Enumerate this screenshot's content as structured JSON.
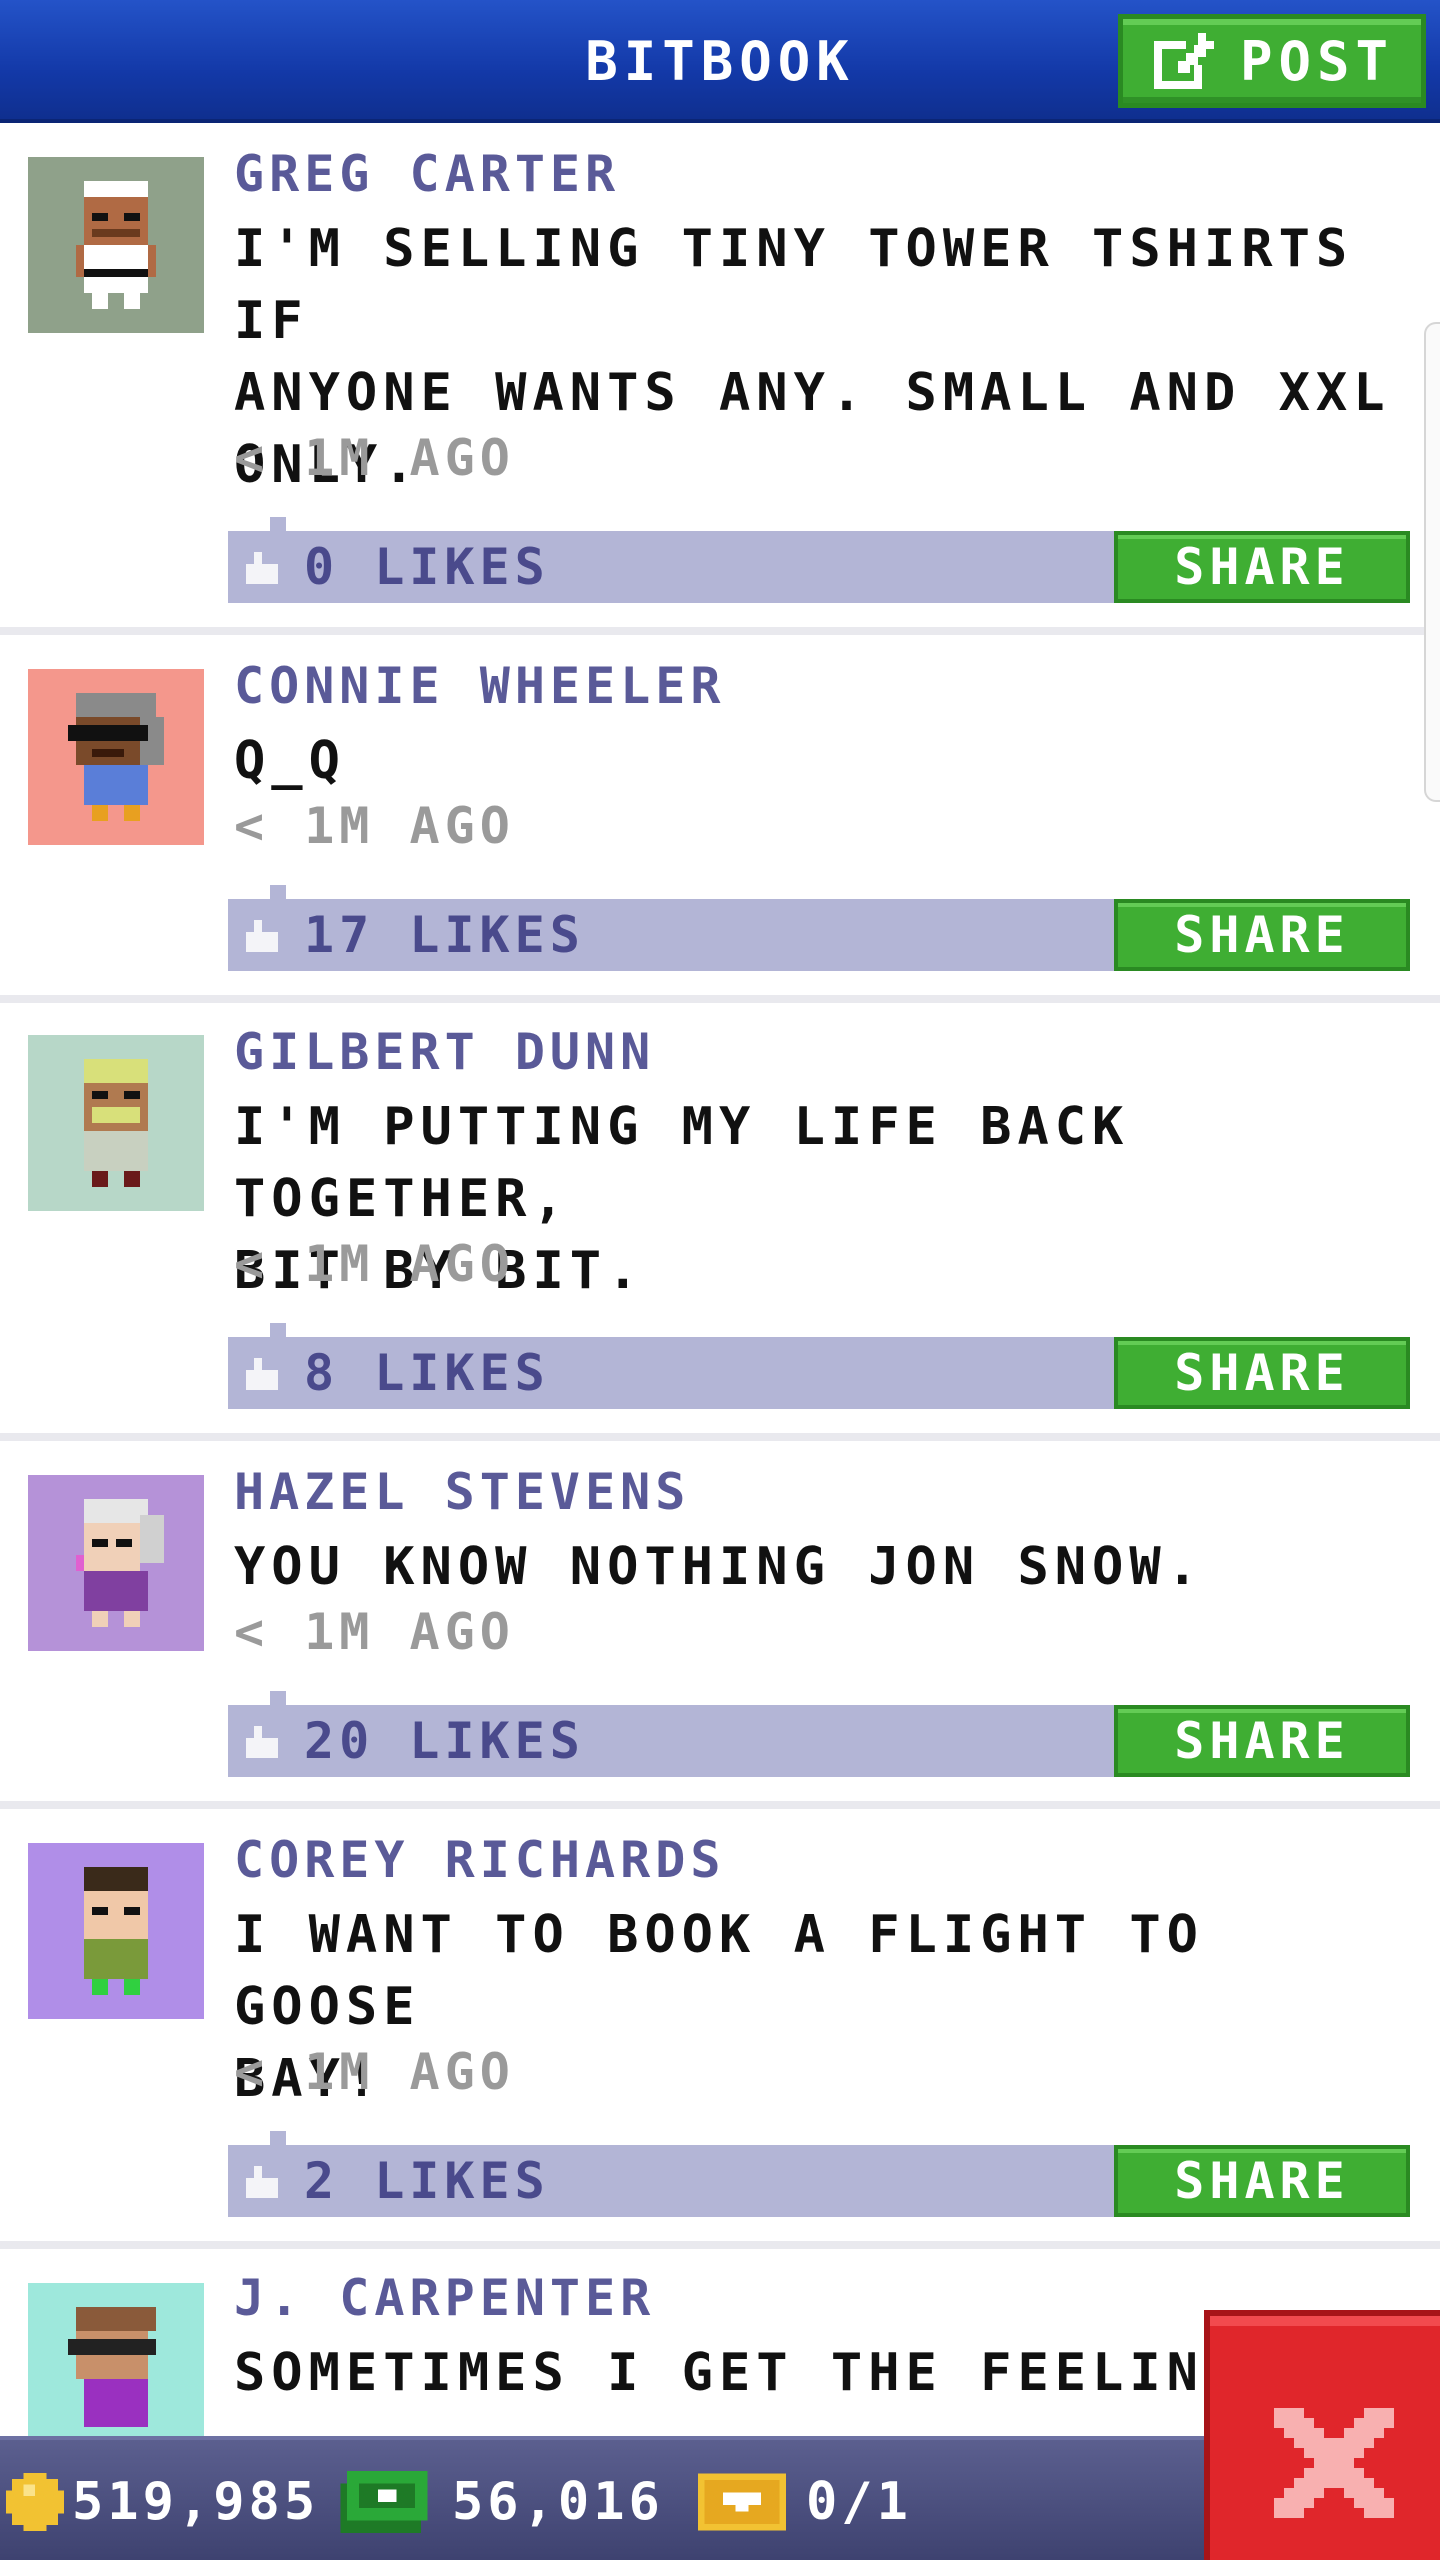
{
  "header": {
    "title": "BITBOOK",
    "post_label": "POST"
  },
  "posts": [
    {
      "author": "GREG CARTER",
      "message": "I'M SELLING TINY TOWER TSHIRTS IF\nANYONE WANTS ANY. SMALL AND XXL\nONLY.",
      "time": "< 1M AGO",
      "likes": "0 LIKES",
      "share_label": "SHARE",
      "avatar_bg": "#8fa18a"
    },
    {
      "author": "CONNIE WHEELER",
      "message": "Q_Q",
      "time": "< 1M AGO",
      "likes": "17 LIKES",
      "share_label": "SHARE",
      "avatar_bg": "#f4978c"
    },
    {
      "author": "GILBERT DUNN",
      "message": "I'M PUTTING MY LIFE BACK TOGETHER,\nBIT BY BIT.",
      "time": "< 1M AGO",
      "likes": "8 LIKES",
      "share_label": "SHARE",
      "avatar_bg": "#b7d7c8"
    },
    {
      "author": "HAZEL STEVENS",
      "message": "YOU KNOW NOTHING JON SNOW.",
      "time": "< 1M AGO",
      "likes": "20 LIKES",
      "share_label": "SHARE",
      "avatar_bg": "#b592d8"
    },
    {
      "author": "COREY RICHARDS",
      "message": "I WANT TO BOOK A FLIGHT TO GOOSE\nBAY!",
      "time": "< 1M AGO",
      "likes": "2 LIKES",
      "share_label": "SHARE",
      "avatar_bg": "#b08ee8"
    },
    {
      "author": "J. CARPENTER",
      "message": "SOMETIMES I GET THE FEELING TH",
      "time": "",
      "likes": "",
      "share_label": "",
      "avatar_bg": "#9ee8dc"
    }
  ],
  "status": {
    "coins": "519,985",
    "bux": "56,016",
    "tickets": "0/1"
  },
  "colors": {
    "header_blue": "#1339a8",
    "button_green": "#3fae33",
    "like_bar": "#b3b5d6",
    "author_text": "#5a5a98",
    "close_red": "#e0262b"
  },
  "icons": [
    "post-edit-icon",
    "like-icon",
    "coin-icon",
    "bux-icon",
    "ticket-icon",
    "close-x-icon"
  ]
}
